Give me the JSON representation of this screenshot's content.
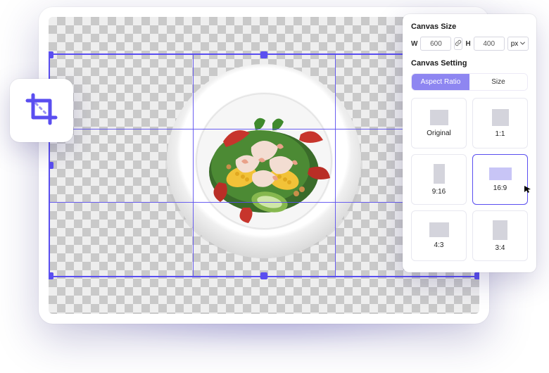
{
  "canvas_size": {
    "title": "Canvas Size",
    "width_label": "W",
    "width_value": "600",
    "height_label": "H",
    "height_value": "400",
    "unit": "px"
  },
  "canvas_setting": {
    "title": "Canvas Setting",
    "tabs": {
      "aspect_ratio": "Aspect Ratio",
      "size": "Size"
    }
  },
  "ratios": {
    "original": "Original",
    "one_one": "1:1",
    "nine_sixteen": "9:16",
    "sixteen_nine": "16:9",
    "four_three": "4:3",
    "three_four": "3:4"
  },
  "image_subject": "shrimp-salad-plate"
}
